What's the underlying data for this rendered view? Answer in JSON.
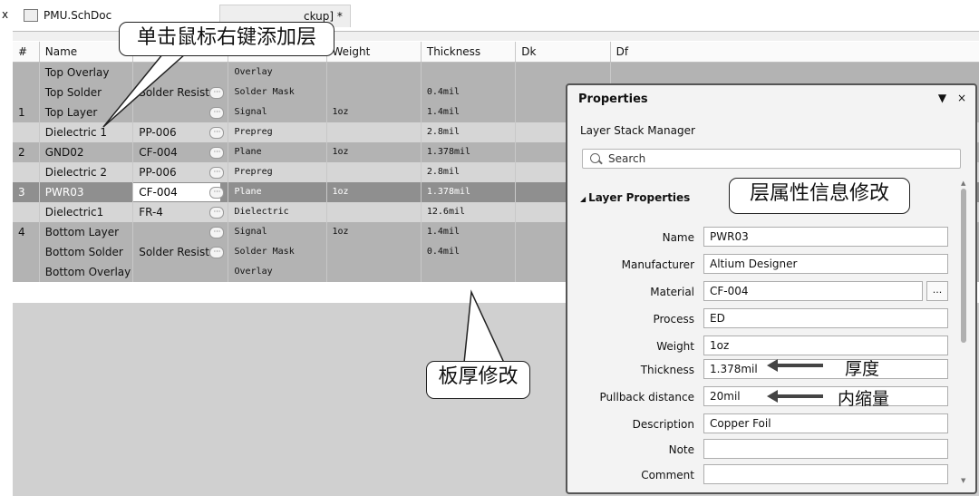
{
  "tabs": {
    "close_glyph": "x",
    "tab1": "PMU.SchDoc",
    "tab2": "ckup] *"
  },
  "table": {
    "headers": [
      "#",
      "Name",
      "",
      "",
      "Weight",
      "Thickness",
      "Dk",
      "Df"
    ],
    "rows": [
      {
        "num": "",
        "name": "Top Overlay",
        "material": "",
        "more": false,
        "type": "Overlay",
        "weight": "",
        "thickness": "",
        "style": "dark"
      },
      {
        "num": "",
        "name": "Top Solder",
        "material": "Solder Resist",
        "more": true,
        "type": "Solder Mask",
        "weight": "",
        "thickness": "0.4mil",
        "style": "dark"
      },
      {
        "num": "1",
        "name": "Top Layer",
        "material": "",
        "more": true,
        "type": "Signal",
        "weight": "1oz",
        "thickness": "1.4mil",
        "style": "dark"
      },
      {
        "num": "",
        "name": "Dielectric 1",
        "material": "PP-006",
        "more": true,
        "type": "Prepreg",
        "weight": "",
        "thickness": "2.8mil",
        "style": "light"
      },
      {
        "num": "2",
        "name": "GND02",
        "material": "CF-004",
        "more": true,
        "type": "Plane",
        "weight": "1oz",
        "thickness": "1.378mil",
        "style": "dark"
      },
      {
        "num": "",
        "name": "Dielectric 2",
        "material": "PP-006",
        "more": true,
        "type": "Prepreg",
        "weight": "",
        "thickness": "2.8mil",
        "style": "light"
      },
      {
        "num": "3",
        "name": "PWR03",
        "material": "CF-004",
        "more": true,
        "type": "Plane",
        "weight": "1oz",
        "thickness": "1.378mil",
        "style": "sel"
      },
      {
        "num": "",
        "name": "Dielectric1",
        "material": "FR-4",
        "more": true,
        "type": "Dielectric",
        "weight": "",
        "thickness": "12.6mil",
        "style": "light"
      },
      {
        "num": "4",
        "name": "Bottom Layer",
        "material": "",
        "more": true,
        "type": "Signal",
        "weight": "1oz",
        "thickness": "1.4mil",
        "style": "dark"
      },
      {
        "num": "",
        "name": "Bottom Solder",
        "material": "Solder Resist",
        "more": true,
        "type": "Solder Mask",
        "weight": "",
        "thickness": "0.4mil",
        "style": "dark"
      },
      {
        "num": "",
        "name": "Bottom Overlay",
        "material": "",
        "more": false,
        "type": "Overlay",
        "weight": "",
        "thickness": "",
        "style": "dark"
      }
    ]
  },
  "callouts": {
    "add_layer": "单击鼠标右键添加层",
    "layer_props": "层属性信息修改",
    "board_thickness": "板厚修改"
  },
  "properties": {
    "title": "Properties",
    "menu_glyph": "▼",
    "close_glyph": "×",
    "subtitle": "Layer Stack Manager",
    "search_placeholder": "Search",
    "section": "Layer Properties",
    "section_glyph": "◢",
    "dots_label": "...",
    "fields": [
      {
        "label": "Name",
        "value": "PWR03"
      },
      {
        "label": "Manufacturer",
        "value": "Altium Designer"
      },
      {
        "label": "Material",
        "value": "CF-004"
      },
      {
        "label": "Process",
        "value": "ED"
      },
      {
        "label": "Weight",
        "value": "1oz"
      },
      {
        "label": "Thickness",
        "value": "1.378mil"
      },
      {
        "label": "Pullback distance",
        "value": "20mil"
      },
      {
        "label": "Description",
        "value": "Copper Foil"
      },
      {
        "label": "Note",
        "value": ""
      },
      {
        "label": "Comment",
        "value": ""
      }
    ],
    "annotations": {
      "thickness": "厚度",
      "pullback": "内缩量"
    }
  }
}
